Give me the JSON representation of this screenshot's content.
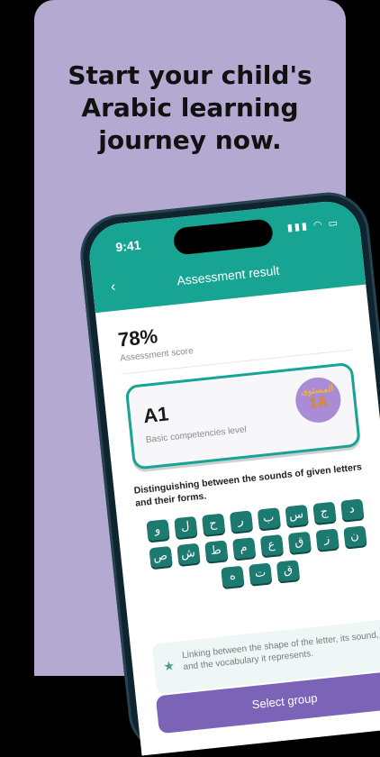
{
  "headline": {
    "line1": "Start your child's",
    "line2": "Arabic learning",
    "line3": "journey now."
  },
  "status_bar": {
    "time": "9:41",
    "icons": "signal-icon wifi-icon battery-icon"
  },
  "nav": {
    "back_icon": "chevron-left-icon",
    "title": "Assessment result"
  },
  "score": {
    "value": "78%",
    "label": "Assessment score"
  },
  "level": {
    "code": "A1",
    "description": "Basic competencies level",
    "badge_arabic": "المستوى",
    "badge_level": "1A"
  },
  "skill1": {
    "text": "Distinguishing between the sounds of given letters and their forms.",
    "letters": [
      "د",
      "ج",
      "س",
      "ب",
      "ر",
      "ح",
      "ل",
      "و",
      "ن",
      "ز",
      "ق",
      "ع",
      "م",
      "ط",
      "ش",
      "ص",
      "ق",
      "ت",
      "ه"
    ]
  },
  "skill2": {
    "icon": "star-icon",
    "text": "Linking between the shape of the letter, its sound, and the vocabulary it represents."
  },
  "cta": {
    "label": "Select group"
  },
  "colors": {
    "background": "#b3a9d1",
    "teal": "#17a493",
    "letter_tile": "#1d7a71",
    "purple_button": "#7b64b7"
  }
}
